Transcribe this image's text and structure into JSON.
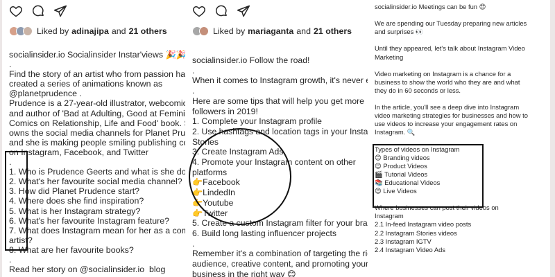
{
  "panel1": {
    "liked_by_prefix": "Liked by",
    "liked_by_user": "adinajipa",
    "liked_and": "and",
    "liked_others": "21 others",
    "avatar_colors": [
      "#d6a08a",
      "#8e9bb0",
      "#c9b3a6"
    ],
    "caption": "socialinsider.io Socialinsider Instar'views 🎉🎉\n.\nFind the story of an artist who from passion has\ncreated a series of animations known as\n@planetprudence .\nPrudence is a 27-year-old illustrator, webcomic ,\nand author of 'Bad at Adulting, Good at Feminism'\nComics on Relationship, Life and Food' book. She\nowns the social media channels for Planet Prudence\nand she is making people smiling publishing content\non Instagram, Facebook, and Twitter\n.\n1. Who is Prudence Geerts and what is she doing?\n2. What's her favourite social media channel?\n3. How did Planet Prudence start?\n4. Where does she find inspiration?\n5. What is her Instagram strategy?\n6. What's her favourite Instagram feature?\n7. What does Instagram mean for her as a comic\nartist?\n8. What are her favourite books?\n.\nRead her story on @socialinsider.io  blog"
  },
  "panel2": {
    "liked_by_prefix": "Liked by",
    "liked_by_user": "mariaganta",
    "liked_and": "and",
    "liked_others": "21 others",
    "avatar_colors": [
      "#a7a7a7",
      "#c48f7a"
    ],
    "caption": "socialinsider.io Follow the road!\n.\nWhen it comes to Instagram growth, it's never easy\n.\nHere are some tips that will help you get more\nfollowers in 2019!\n1. Complete your Instagram profile\n2. Use hashtags and location tags in your Instagram\nStories\n3. Create Instagram Ads\n4. Promote your Instagram content on other\nplatforms\n👉Facebook\n👉LindedIn\n👉Youtube\n👉Twitter\n5. Create a custom Instagram filter for your brand\n6. Build long lasting influencer projects\n.\nRemember it's a combination of targeting the right\naudience, creative content, and promoting your\nbusiness in the right way 😊"
  },
  "panel3": {
    "caption": "socialinsider.io Meetings can be fun 😍\n\nWe are spending our Tuesday preparing new articles\nand surprises 👀\n\nUntil they appeared, let's talk about Instagram Video\nMarketing\n\nVideo marketing on Instagram is a chance for a\nbusiness to show the world who they are and what\nthey do in 60 seconds or less.\n\nIn the article, you'll see a deep dive into Instagram\nvideo marketing strategies for businesses and how to\nuse videos to increase your engagement rates on\nInstagram. 🔍\n\nTypes of videos on Instagram\n😊 Branding videos\n😊 Product Videos\n🎬 Tutorial Videos\n📚 Educational Videos\n😍 Live Videos\n\nWhere businesses can post their videos on\nInstagram\n2.1 In-feed Instagram video posts\n2.2 Instagram Stories videos\n2.3 Instagram IGTV\n2.4 Instagram Video Ads"
  },
  "icons": [
    "heart-icon",
    "comment-icon",
    "share-icon"
  ],
  "colors": {
    "background": "#ece7e7",
    "panel": "#ffffff",
    "text": "#262626",
    "highlight": "#111111"
  }
}
